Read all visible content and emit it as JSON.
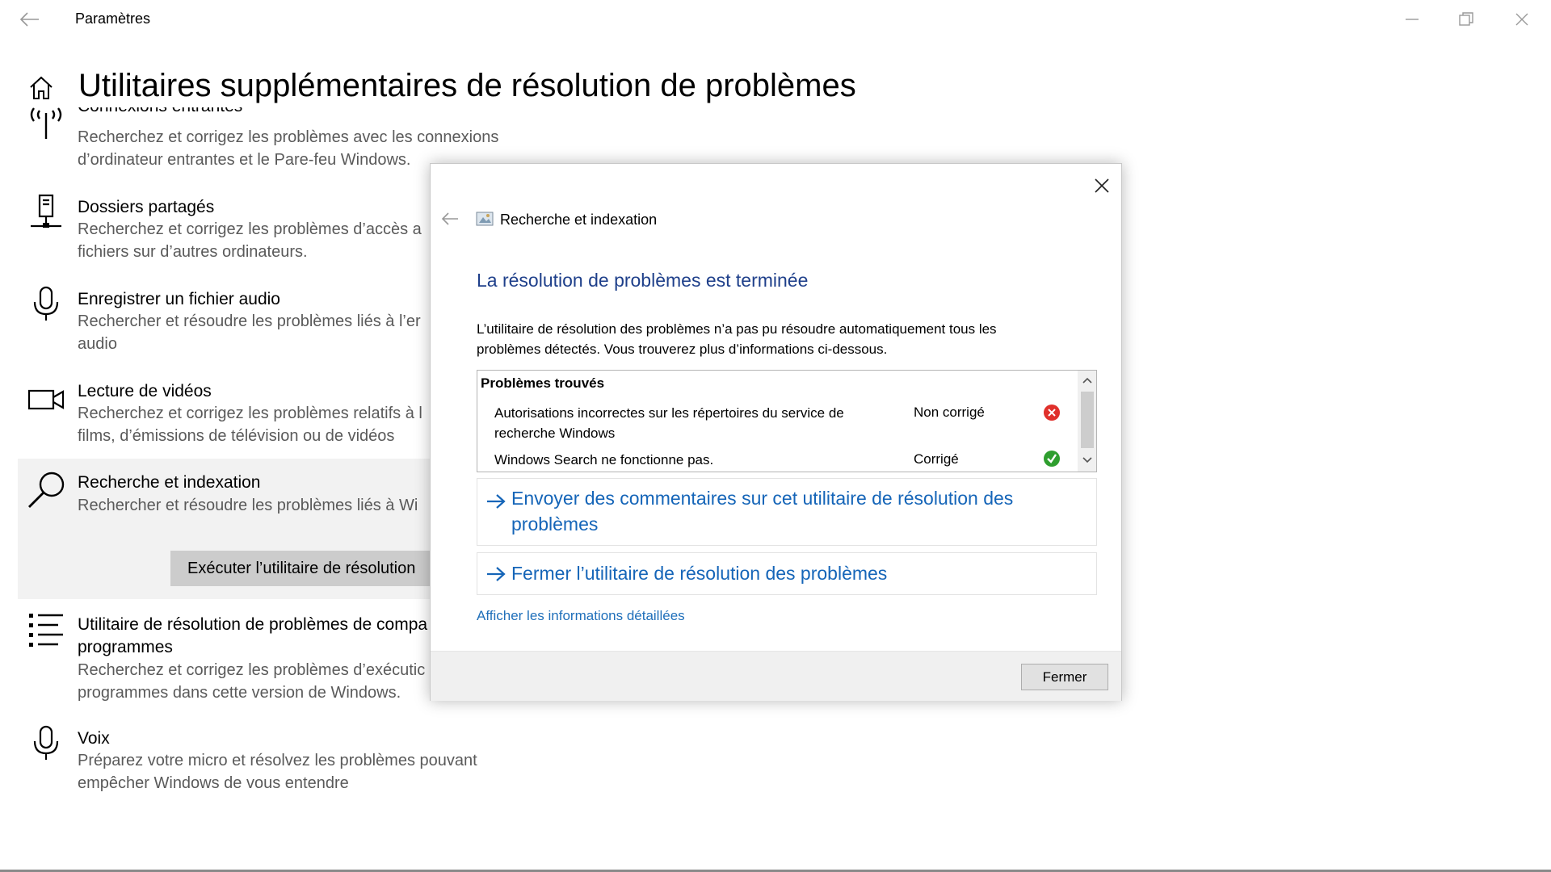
{
  "window": {
    "title": "Paramètres"
  },
  "page": {
    "title": "Utilitaires supplémentaires de résolution de problèmes"
  },
  "items": [
    {
      "name": "Connexions entrantes",
      "desc": "Recherchez et corrigez les problèmes avec les connexions d’ordinateur entrantes et le Pare-feu Windows.",
      "icon": "antenna-icon"
    },
    {
      "name": "Dossiers partagés",
      "desc": "Recherchez et corrigez les problèmes d’accès a fichiers sur d’autres ordinateurs.",
      "icon": "shared-folder-icon"
    },
    {
      "name": "Enregistrer un fichier audio",
      "desc": "Rechercher et résoudre les problèmes liés à l’er audio",
      "icon": "microphone-icon"
    },
    {
      "name": "Lecture de vidéos",
      "desc": "Recherchez et corrigez les problèmes relatifs à l films, d’émissions de télévision ou de vidéos",
      "icon": "video-camera-icon"
    },
    {
      "name": "Recherche et indexation",
      "desc": "Rechercher et résoudre les problèmes liés à Wi",
      "icon": "search-icon",
      "button": "Exécuter l’utilitaire de résolution"
    },
    {
      "name": "Utilitaire de résolution de problèmes de compa programmes",
      "desc": "Recherchez et corrigez les problèmes d’exécutic programmes dans cette version de Windows.",
      "icon": "list-icon"
    },
    {
      "name": "Voix",
      "desc": "Préparez votre micro et résolvez les problèmes pouvant empêcher Windows de vous entendre",
      "icon": "microphone-icon"
    }
  ],
  "dialog": {
    "app_title": "Recherche et indexation",
    "heading": "La résolution de problèmes est terminée",
    "message": "L’utilitaire de résolution des problèmes n’a pas pu résoudre automatiquement tous les problèmes détectés. Vous trouverez plus d’informations ci-dessous.",
    "problems_header": "Problèmes trouvés",
    "problems": [
      {
        "desc": "Autorisations incorrectes sur les répertoires du service de recherche Windows",
        "status": "Non corrigé",
        "status_icon": "error-icon",
        "status_color": "#e0302b"
      },
      {
        "desc": "Windows Search ne fonctionne pas.",
        "status": "Corrigé",
        "status_icon": "check-icon",
        "status_color": "#2e9e2e"
      }
    ],
    "links": [
      "Envoyer des commentaires sur cet utilitaire de résolution des problèmes",
      "Fermer l’utilitaire de résolution des problèmes"
    ],
    "details_link": "Afficher les informations détaillées",
    "close_button": "Fermer"
  },
  "colors": {
    "heading_blue": "#1e3f8a",
    "link_blue": "#1565b8",
    "selected_bg": "#f2f2f2"
  }
}
